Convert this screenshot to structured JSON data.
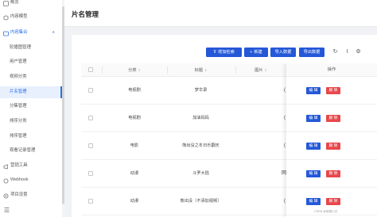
{
  "sidebar": {
    "items": [
      {
        "label": "概览",
        "icon": "overview-icon"
      },
      {
        "label": "内容模型",
        "icon": "model-icon"
      },
      {
        "label": "内容集合",
        "icon": "collection-icon",
        "open": true
      },
      {
        "label": "轮播图管理"
      },
      {
        "label": "用户管理"
      },
      {
        "label": "视频分类"
      },
      {
        "label": "片名管理",
        "active": true
      },
      {
        "label": "分集管理"
      },
      {
        "label": "排序分类"
      },
      {
        "label": "排序管理"
      },
      {
        "label": "观看记录管理"
      },
      {
        "label": "营销工具",
        "icon": "marketing-icon"
      },
      {
        "label": "Webhook",
        "icon": "webhook-icon"
      },
      {
        "label": "项目设置",
        "icon": "settings-icon"
      }
    ],
    "collapse_icon": "menu-collapse-icon"
  },
  "header": {
    "title": "片名管理"
  },
  "toolbar": {
    "advanced_search": "增加检索",
    "add": "新建",
    "import": "导入数据",
    "export": "导出数据",
    "add_glyph": "+",
    "search_glyph": "⊽",
    "icons": [
      "refresh-icon",
      "column-height-icon",
      "gear-icon"
    ]
  },
  "table": {
    "columns": [
      "分类",
      "标题",
      "图片",
      "操作"
    ],
    "rows": [
      {
        "category": "电视剧",
        "title": "梦华录",
        "image": "(",
        "edit": "编 辑",
        "delete": "删 除"
      },
      {
        "category": "电视剧",
        "title": "加油妈妈",
        "image": "(",
        "edit": "编 辑",
        "delete": "删 除"
      },
      {
        "category": "电影",
        "title": "熊出没之冬日乐翻天",
        "image": "(",
        "edit": "编 辑",
        "delete": "删 除"
      },
      {
        "category": "动漫",
        "title": "斗罗大陆",
        "image": "网",
        "edit": "编 辑",
        "delete": "删 除"
      },
      {
        "category": "动漫",
        "title": "熊出没（不添加视频）",
        "image": "(",
        "edit": "编 辑",
        "delete": "删 除"
      }
    ]
  },
  "watermark": "CSDN @前端小白"
}
